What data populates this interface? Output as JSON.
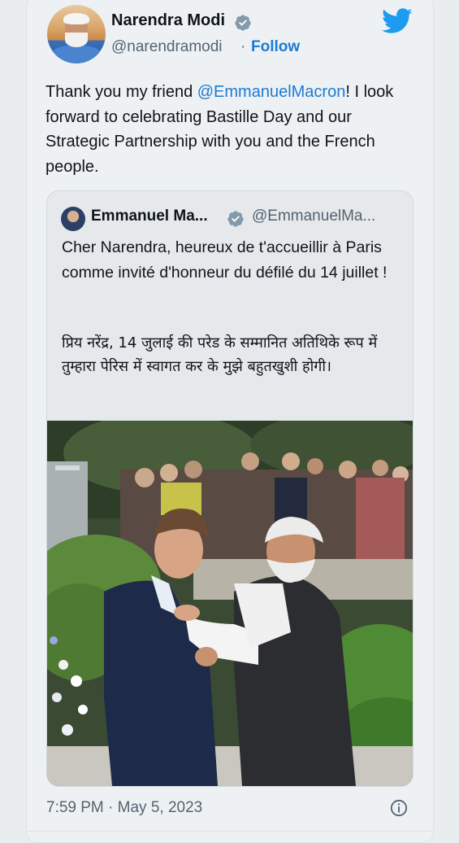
{
  "tweet": {
    "author_name": "Narendra Modi",
    "author_handle": "@narendramodi",
    "separator": "·",
    "follow_label": "Follow",
    "text_before": "Thank you my friend ",
    "mention": "@EmmanuelMacron",
    "text_after": "! I look forward to celebrating Bastille Day and our Strategic Partnership with you and the French people.",
    "timestamp": "7:59 PM · May 5, 2023"
  },
  "quoted": {
    "author_name": "Emmanuel Ma...",
    "author_handle": "@EmmanuelMa...",
    "text_fr": "Cher Narendra, heureux de t'accueillir à Paris comme invité d'honneur du défilé du 14 juillet !",
    "text_hi": "प्रिय नरेंद्र, 14 जुलाई की परेड के सम्मानित अतिथिके रूप में तुम्हारा पेरिस में स्वागत कर के मुझे बहुतखुशी होगी।"
  },
  "colors": {
    "accent": "#1d7bd1",
    "twitter_blue": "#1d9bf0",
    "verified_gray": "#829aab"
  },
  "icons": [
    "verified-badge-icon",
    "twitter-bird-icon",
    "info-icon"
  ]
}
